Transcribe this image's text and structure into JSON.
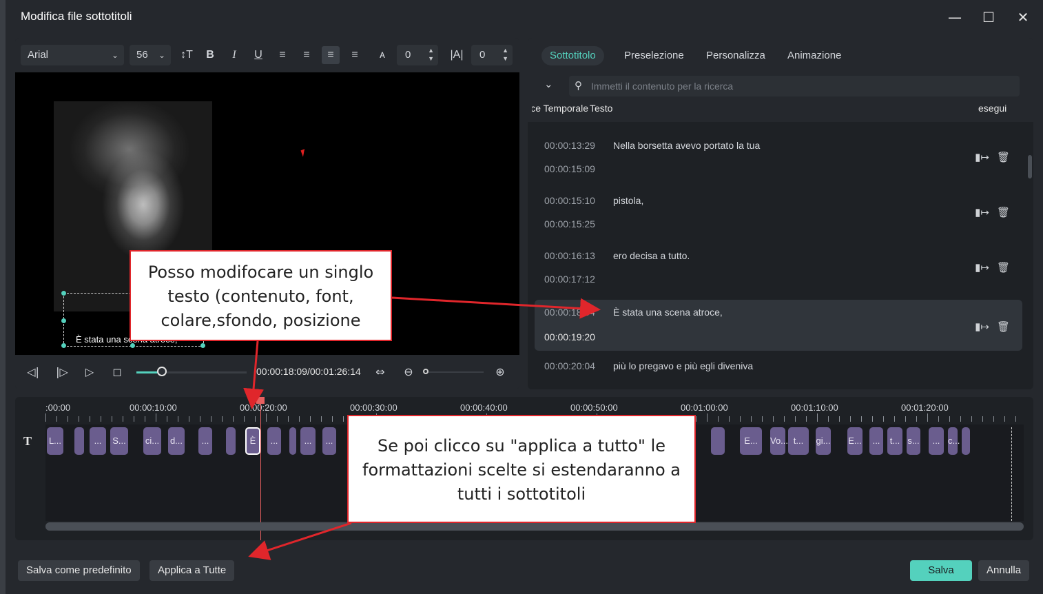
{
  "window": {
    "title": "Modifica file sottotitoli",
    "minimize_icon": "minimize-icon",
    "maximize_icon": "maximize-icon",
    "close_icon": "close-icon"
  },
  "toolbar": {
    "font": "Arial",
    "size": "56",
    "char_spacing": "0",
    "line_spacing": "0",
    "icons": [
      "text-height-icon",
      "bold-icon",
      "italic-icon",
      "underline-icon",
      "align-left-icon",
      "align-right-icon",
      "align-center-icon",
      "justify-icon",
      "spacing-icon",
      "kerning-icon"
    ]
  },
  "preview": {
    "subtitle_text": "È stata una scena atroce,"
  },
  "playback": {
    "timecode": "00:00:18:09/00:01:26:14",
    "progress_fraction": 0.23
  },
  "tabs": [
    "Sottotitolo",
    "Preselezione",
    "Personalizza",
    "Animazione"
  ],
  "search": {
    "placeholder": "Immetti il contenuto per la ricerca"
  },
  "columns": {
    "timecode": "Codice Temporale",
    "text": "Testo",
    "action": "esegui"
  },
  "subtitles": [
    {
      "start": "00:00:13:29",
      "end": "00:00:15:09",
      "text": "Nella borsetta avevo portato la tua"
    },
    {
      "start": "00:00:15:10",
      "end": "00:00:15:25",
      "text": "pistola,"
    },
    {
      "start": "00:00:16:13",
      "end": "00:00:17:12",
      "text": "ero decisa a tutto."
    },
    {
      "start": "00:00:18:04",
      "end": "00:00:19:20",
      "text": "È stata una scena atroce,",
      "selected": true
    },
    {
      "start": "00:00:20:04",
      "end": "",
      "text": "più lo pregavo e più egli diveniva"
    }
  ],
  "timeline": {
    "ruler": [
      ":00:00",
      "00:00:10:00",
      "00:00:20:00",
      "00:00:30:00",
      "00:00:40:00",
      "00:00:50:00",
      "00:01:00:00",
      "00:01:10:00",
      "00:01:20:00"
    ],
    "clips": [
      "L...",
      "",
      "...",
      "S...",
      "ci...",
      "d...",
      "...",
      "",
      "È",
      "...",
      "",
      "...",
      "...",
      "",
      "",
      "E...",
      "Vo...",
      "t...",
      "gi...",
      "E...",
      "...",
      "t...",
      "s...",
      "...",
      "c...",
      "",
      ""
    ]
  },
  "buttons": {
    "save_default": "Salva come predefinito",
    "apply_all": "Applica a Tutte",
    "save": "Salva",
    "cancel": "Annulla"
  },
  "annotations": {
    "callout1": "Posso modifocare un singlo testo (contenuto, font, colare,sfondo, posizione",
    "callout2": "Se poi clicco su \"applica a tutto\" le formattazioni scelte si estendaranno a tutti i sottotitoli",
    "color": "#e0262b"
  },
  "colors": {
    "accent": "#54d1bd",
    "clip": "#6a5d8e",
    "panel": "#1e2125"
  }
}
